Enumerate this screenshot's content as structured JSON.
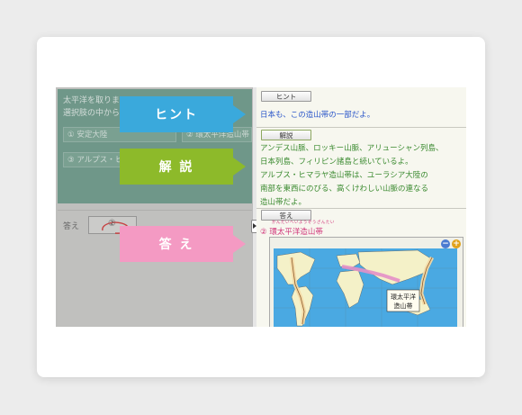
{
  "question": {
    "text_line1": "太平洋を取りま",
    "text_line2": "選択肢の中から",
    "choices": [
      "① 安定大陸",
      "② 環太平洋造山帯",
      "③ アルプス・ヒ"
    ]
  },
  "answer_input": {
    "label": "答え",
    "value": "②"
  },
  "tabs": {
    "hint": "ヒント",
    "explanation": "解 説",
    "answer": "答 え"
  },
  "panel": {
    "hint_button": "ヒント",
    "hint_text": "日本も、この造山帯の一部だよ。",
    "explanation_button": "解説",
    "explanation_lines": [
      "アンデス山脈、ロッキー山脈、アリューシャン列島、",
      "日本列島、フィリピン諸島と続いているよ。",
      "アルプス・ヒマラヤ造山帯は、ユーラシア大陸の",
      "南部を東西にのびる、高くけわしい山脈の連なる",
      "造山帯だよ。"
    ],
    "answer_button": "答え",
    "answer_text": "② 環太平洋造山帯",
    "answer_ruby": "かんたいへいようぞうざんたい",
    "map_label_line1": "環太平洋",
    "map_label_line2": "造山帯"
  },
  "colors": {
    "hint_tab": "#3aa9dc",
    "explanation_tab": "#8dba2a",
    "answer_tab": "#f49ac3"
  }
}
